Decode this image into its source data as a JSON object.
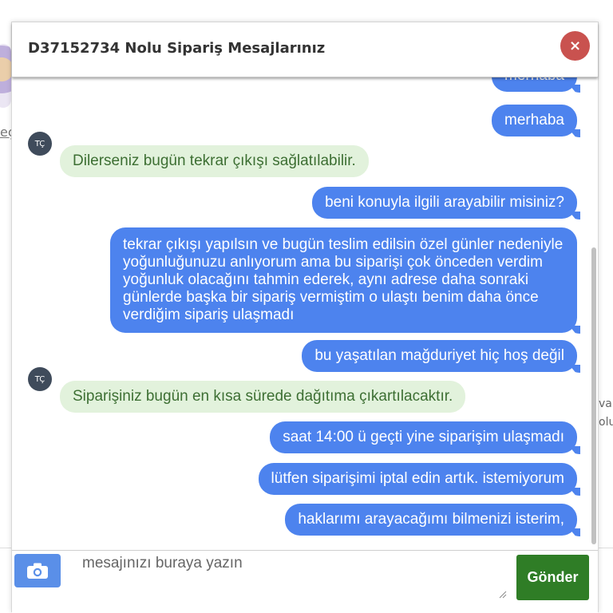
{
  "modal": {
    "title": "D37152734 Nolu Sipariş Mesajlarınız",
    "close_label": "×"
  },
  "messages": [
    {
      "from": "user",
      "text": "merhaba"
    },
    {
      "from": "user",
      "text": "merhaba"
    },
    {
      "from": "agent",
      "avatar": "TÇ",
      "text": "Dilerseniz bugün tekrar çıkışı sağlatılabilir."
    },
    {
      "from": "user",
      "text": "beni konuyla ilgili arayabilir misiniz?"
    },
    {
      "from": "user",
      "text": "tekrar çıkışı yapılsın ve bugün teslim edilsin özel günler nedeniyle yoğunluğunuzu anlıyorum ama bu siparişi çok önceden verdim yoğunluk olacağını tahmin ederek, aynı adrese daha sonraki günlerde başka bir sipariş vermiştim o ulaştı benim daha önce verdiğim sipariş ulaşmadı"
    },
    {
      "from": "user",
      "text": "bu yaşatılan mağduriyet hiç hoş değil"
    },
    {
      "from": "agent",
      "avatar": "TÇ",
      "text": "Siparişiniz bugün en kısa sürede dağıtıma çıkartılacaktır."
    },
    {
      "from": "user",
      "text": "saat 14:00 ü geçti yine siparişim ulaşmadı"
    },
    {
      "from": "user",
      "text": "lütfen siparişimi iptal edin artık. istemiyorum"
    },
    {
      "from": "user",
      "text": "haklarımı arayacağımı bilmenizi isterim,"
    }
  ],
  "composer": {
    "placeholder": "mesajınızı buraya yazın",
    "value": "",
    "send_label": "Gönder",
    "attach_icon": "camera-icon"
  },
  "background": {
    "left_fragment": "eç",
    "right_fragment_1": "var",
    "right_fragment_2": "olu"
  },
  "colors": {
    "user_bubble": "#4d83ee",
    "agent_bubble": "#e2f2dc",
    "agent_text": "#3d6f33",
    "send_button": "#2f7d26",
    "close_button": "#c9524f",
    "avatar": "#3f4b5b"
  }
}
